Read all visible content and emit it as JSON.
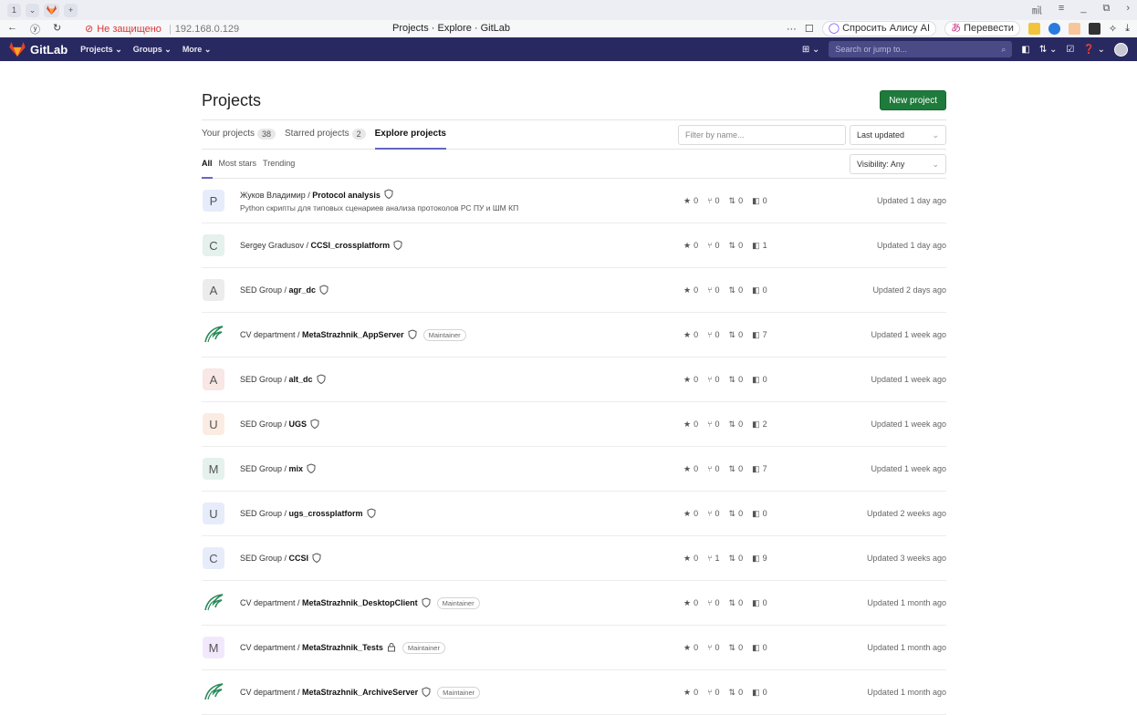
{
  "browser": {
    "tab_count": "1",
    "page_title": "Projects · Explore · GitLab",
    "insecure_label": "Не защищено",
    "url": "192.168.0.129",
    "alice_button": "Спросить Алису AI",
    "translate_button": "Перевести"
  },
  "gitlab_nav": {
    "brand": "GitLab",
    "projects_menu": "Projects",
    "groups_menu": "Groups",
    "more_menu": "More",
    "search_placeholder": "Search or jump to..."
  },
  "page": {
    "title": "Projects",
    "new_project_button": "New project",
    "tabs": [
      {
        "label": "Your projects",
        "count": "38"
      },
      {
        "label": "Starred projects",
        "count": "2"
      },
      {
        "label": "Explore projects"
      }
    ],
    "filter_placeholder": "Filter by name...",
    "sort_value": "Last updated",
    "subtabs": [
      "All",
      "Most stars",
      "Trending"
    ],
    "visibility_value": "Visibility: Any"
  },
  "projects": [
    {
      "avatar": "P",
      "avatar_color": "#e7ecfb",
      "namespace": "Жуков Владимир / ",
      "name": "Protocol analysis",
      "description": "Python скрипты для типовых сценариев анализа протоколов РС ПУ и ШМ КП",
      "stars": "0",
      "forks": "0",
      "mrs": "0",
      "issues": "0",
      "updated": "Updated 1 day ago",
      "lock": false
    },
    {
      "avatar": "C",
      "avatar_color": "#e5f1ec",
      "namespace": "Sergey Gradusov / ",
      "name": "CCSI_crossplatform",
      "stars": "0",
      "forks": "0",
      "mrs": "0",
      "issues": "1",
      "updated": "Updated 1 day ago",
      "lock": false
    },
    {
      "avatar": "A",
      "avatar_color": "#ececec",
      "namespace": "SED Group / ",
      "name": "agr_dc",
      "stars": "0",
      "forks": "0",
      "mrs": "0",
      "issues": "0",
      "updated": "Updated 2 days ago",
      "lock": false
    },
    {
      "avatar": "logo",
      "namespace": "CV department / ",
      "name": "MetaStrazhnik_AppServer",
      "badge": "Maintainer",
      "stars": "0",
      "forks": "0",
      "mrs": "0",
      "issues": "7",
      "updated": "Updated 1 week ago",
      "lock": false
    },
    {
      "avatar": "A",
      "avatar_color": "#f8e7e5",
      "namespace": "SED Group / ",
      "name": "alt_dc",
      "stars": "0",
      "forks": "0",
      "mrs": "0",
      "issues": "0",
      "updated": "Updated 1 week ago",
      "lock": false
    },
    {
      "avatar": "U",
      "avatar_color": "#fbece3",
      "namespace": "SED Group / ",
      "name": "UGS",
      "stars": "0",
      "forks": "0",
      "mrs": "0",
      "issues": "2",
      "updated": "Updated 1 week ago",
      "lock": false
    },
    {
      "avatar": "M",
      "avatar_color": "#e5f1ec",
      "namespace": "SED Group / ",
      "name": "mix",
      "stars": "0",
      "forks": "0",
      "mrs": "0",
      "issues": "7",
      "updated": "Updated 1 week ago",
      "lock": false
    },
    {
      "avatar": "U",
      "avatar_color": "#e7ecfb",
      "namespace": "SED Group / ",
      "name": "ugs_crossplatform",
      "stars": "0",
      "forks": "0",
      "mrs": "0",
      "issues": "0",
      "updated": "Updated 2 weeks ago",
      "lock": false
    },
    {
      "avatar": "C",
      "avatar_color": "#e7ecfb",
      "namespace": "SED Group / ",
      "name": "CCSI",
      "stars": "0",
      "forks": "1",
      "mrs": "0",
      "issues": "9",
      "updated": "Updated 3 weeks ago",
      "lock": false
    },
    {
      "avatar": "logo",
      "namespace": "CV department / ",
      "name": "MetaStrazhnik_DesktopClient",
      "badge": "Maintainer",
      "stars": "0",
      "forks": "0",
      "mrs": "0",
      "issues": "0",
      "updated": "Updated 1 month ago",
      "lock": false
    },
    {
      "avatar": "M",
      "avatar_color": "#f1e9fb",
      "namespace": "CV department / ",
      "name": "MetaStrazhnik_Tests",
      "badge": "Maintainer",
      "stars": "0",
      "forks": "0",
      "mrs": "0",
      "issues": "0",
      "updated": "Updated 1 month ago",
      "lock": true
    },
    {
      "avatar": "logo",
      "namespace": "CV department / ",
      "name": "MetaStrazhnik_ArchiveServer",
      "badge": "Maintainer",
      "stars": "0",
      "forks": "0",
      "mrs": "0",
      "issues": "0",
      "updated": "Updated 1 month ago",
      "lock": false
    }
  ]
}
